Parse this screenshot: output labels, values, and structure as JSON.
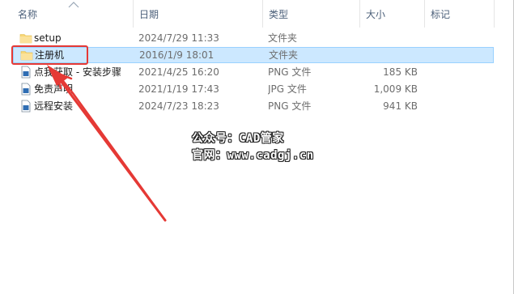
{
  "columns": {
    "name": "名称",
    "date": "日期",
    "type": "类型",
    "size": "大小",
    "tags": "标记"
  },
  "files": [
    {
      "name": "setup",
      "date": "2024/7/29 11:33",
      "type": "文件夹",
      "size": "",
      "icon": "folder-icon",
      "selected": false
    },
    {
      "name": "注册机",
      "date": "2016/1/9 18:01",
      "type": "文件夹",
      "size": "",
      "icon": "folder-icon",
      "selected": true
    },
    {
      "name": "点我获取 - 安装步骤",
      "date": "2021/4/25 16:20",
      "type": "PNG 文件",
      "size": "185 KB",
      "icon": "image-file-icon",
      "selected": false
    },
    {
      "name": "免责声明",
      "date": "2021/1/19 17:43",
      "type": "JPG 文件",
      "size": "1,009 KB",
      "icon": "image-file-icon",
      "selected": false
    },
    {
      "name": "远程安装",
      "date": "2024/7/23 18:23",
      "type": "PNG 文件",
      "size": "941 KB",
      "icon": "image-file-icon",
      "selected": false
    }
  ],
  "watermark": {
    "line1": "公众号：CAD管家",
    "line2": "官网：www.cadgj.cn"
  },
  "colors": {
    "selection_bg": "#cce8ff",
    "selection_border": "#99d1ff",
    "annotation_red": "#e53935",
    "folder_yellow": "#f8d775"
  }
}
